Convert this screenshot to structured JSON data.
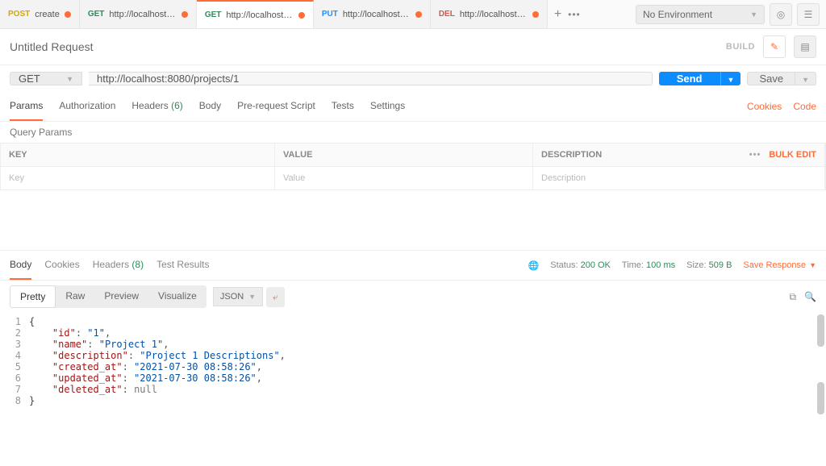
{
  "environment": {
    "label": "No Environment"
  },
  "tabs": [
    {
      "method": "POST",
      "label": "create",
      "dirty": true
    },
    {
      "method": "GET",
      "label": "http://localhost:80...",
      "dirty": true
    },
    {
      "method": "GET",
      "label": "http://localhost:80...",
      "dirty": true,
      "active": true
    },
    {
      "method": "PUT",
      "label": "http://localhost:80...",
      "dirty": true
    },
    {
      "method": "DEL",
      "label": "http://localhost:80...",
      "dirty": true
    }
  ],
  "request": {
    "title": "Untitled Request",
    "build_label": "BUILD",
    "method": "GET",
    "url": "http://localhost:8080/projects/1",
    "send": "Send",
    "save": "Save"
  },
  "sub_tabs": {
    "params": "Params",
    "authorization": "Authorization",
    "headers_label": "Headers",
    "headers_count": "(6)",
    "body": "Body",
    "prerequest": "Pre-request Script",
    "tests": "Tests",
    "settings": "Settings",
    "cookies": "Cookies",
    "code": "Code"
  },
  "params_section": {
    "title": "Query Params",
    "key_label": "KEY",
    "value_label": "VALUE",
    "desc_label": "DESCRIPTION",
    "bulk": "Bulk Edit",
    "key_ph": "Key",
    "value_ph": "Value",
    "desc_ph": "Description"
  },
  "response_tabs": {
    "body": "Body",
    "cookies": "Cookies",
    "headers_label": "Headers",
    "headers_count": "(8)",
    "test_results": "Test Results"
  },
  "response_meta": {
    "status_label": "Status:",
    "status_val": "200 OK",
    "time_label": "Time:",
    "time_val": "100 ms",
    "size_label": "Size:",
    "size_val": "509 B",
    "save_response": "Save Response"
  },
  "viewer": {
    "pretty": "Pretty",
    "raw": "Raw",
    "preview": "Preview",
    "visualize": "Visualize",
    "lang": "JSON"
  },
  "response_body": {
    "id": "1",
    "name": "Project 1",
    "description": "Project 1 Descriptions",
    "created_at": "2021-07-30 08:58:26",
    "updated_at": "2021-07-30 08:58:26",
    "deleted_at": null
  }
}
